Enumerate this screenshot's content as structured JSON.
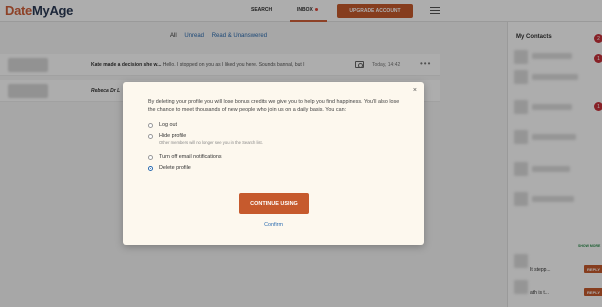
{
  "header": {
    "logo_part1": "Date",
    "logo_part2": "MyAge",
    "nav_search": "SEARCH",
    "nav_inbox": "INBOX",
    "upgrade_label": "UPGRADE ACCOUNT"
  },
  "tabs": {
    "all": "All",
    "unread": "Unread",
    "read_unanswered": "Read & Unanswered"
  },
  "messages": [
    {
      "sender": "Kate made a decision she w...",
      "preview": "Hello. I stopped on you as I liked you here. Sounds bannal, but I",
      "time": "Today, 14:42"
    },
    {
      "sender": "Rebeca Dr L"
    }
  ],
  "sidebar": {
    "title": "My Contacts",
    "badge_count": "2",
    "badge_one": "1",
    "show_more": "SHOW MORE",
    "msg1": "It stepp...",
    "msg2": "ath is t...",
    "reply_label": "REPLY"
  },
  "modal": {
    "close": "×",
    "intro": "By deleting your profile you will lose bonus credits we give you to help you find happiness. You'll also lose the chance to meet thousands of new people who join us on a daily basis. You can:",
    "options": [
      {
        "label": "Log out",
        "sub": ""
      },
      {
        "label": "Hide profile",
        "sub": "Other members will no longer see you in the Search list."
      },
      {
        "label": "Turn off email notifications",
        "sub": ""
      },
      {
        "label": "Delete profile",
        "sub": ""
      }
    ],
    "selected_index": 3,
    "continue_label": "CONTINUE USING",
    "confirm_label": "Confirm"
  },
  "colors": {
    "accent": "#c65a2d",
    "link": "#2a6bb0",
    "badge": "#c8313a"
  }
}
